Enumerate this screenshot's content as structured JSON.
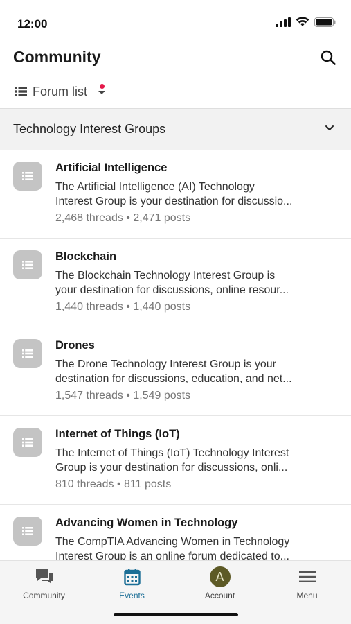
{
  "status_bar": {
    "time": "12:00",
    "icons": [
      "cellular-signal-icon",
      "wifi-icon",
      "battery-icon"
    ]
  },
  "header": {
    "title": "Community",
    "search_icon": "search-icon"
  },
  "forum_list": {
    "label": "Forum list",
    "has_notification": true
  },
  "section": {
    "title": "Technology Interest Groups",
    "expanded": true
  },
  "forums": [
    {
      "name": "Artificial Intelligence",
      "desc_line1": "The Artificial Intelligence (AI) Technology",
      "desc_line2": "Interest Group is your destination for discussio...",
      "stats": "2,468 threads • 2,471 posts"
    },
    {
      "name": "Blockchain",
      "desc_line1": "The Blockchain Technology Interest Group is",
      "desc_line2": "your destination for discussions, online resour...",
      "stats": "1,440 threads • 1,440 posts"
    },
    {
      "name": "Drones",
      "desc_line1": "The Drone Technology Interest Group is your",
      "desc_line2": "destination for discussions, education, and net...",
      "stats": "1,547 threads • 1,549 posts"
    },
    {
      "name": "Internet of Things (IoT)",
      "desc_line1": "The Internet of Things (IoT) Technology Interest",
      "desc_line2": "Group is your destination for discussions, onli...",
      "stats": "810 threads • 811 posts"
    },
    {
      "name": "Advancing Women in Technology",
      "desc_line1": "The CompTIA Advancing Women in Technology",
      "desc_line2": "Interest Group is an online forum dedicated to...",
      "stats": ""
    }
  ],
  "tabs": [
    {
      "label": "Community",
      "icon": "chat-bubbles-icon",
      "active": false
    },
    {
      "label": "Events",
      "icon": "calendar-icon",
      "active": true
    },
    {
      "label": "Account",
      "icon": "avatar",
      "avatar_letter": "A",
      "active": false
    },
    {
      "label": "Menu",
      "icon": "hamburger-menu-icon",
      "active": false
    }
  ],
  "colors": {
    "accent": "#1b6e96",
    "notification_dot": "#e5194a",
    "avatar_bg": "#5d5a26",
    "section_bg": "#f2f2f2",
    "forum_icon_bg": "#c4c4c4"
  }
}
